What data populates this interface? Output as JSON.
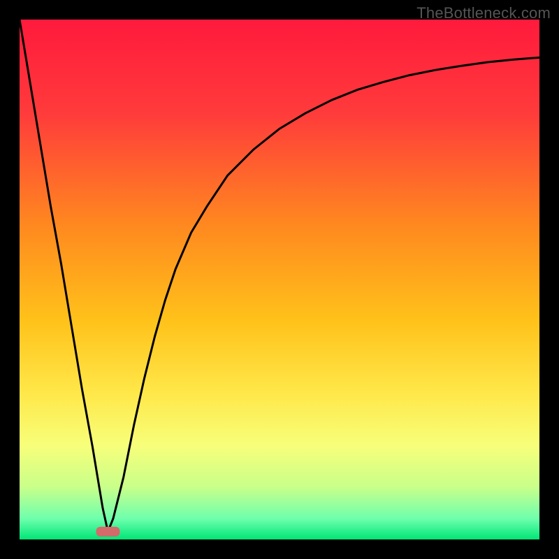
{
  "watermark": "TheBottleneck.com",
  "chart_data": {
    "type": "line",
    "title": "",
    "xlabel": "",
    "ylabel": "",
    "xlim": [
      0,
      100
    ],
    "ylim": [
      0,
      100
    ],
    "grid": false,
    "background_gradient": {
      "top": "#ff1744",
      "upper_mid": "#ff8a00",
      "mid": "#ffd500",
      "lower_mid": "#f4ff6a",
      "near_bottom": "#a8ff78",
      "bottom": "#00e676"
    },
    "marker": {
      "x": 17,
      "y": 1.5,
      "color": "#d46a6a",
      "shape": "rounded-rect"
    },
    "series": [
      {
        "name": "curve",
        "x": [
          0,
          2,
          4,
          6,
          8,
          10,
          12,
          14,
          16,
          17,
          18,
          20,
          22,
          24,
          26,
          28,
          30,
          33,
          36,
          40,
          45,
          50,
          55,
          60,
          65,
          70,
          75,
          80,
          85,
          90,
          95,
          100
        ],
        "values": [
          100,
          88,
          76,
          64,
          53,
          41,
          29,
          18,
          6,
          1.5,
          4,
          12,
          22,
          31,
          39,
          46,
          52,
          59,
          64,
          70,
          75,
          79,
          82,
          84.5,
          86.5,
          88,
          89.3,
          90.3,
          91.1,
          91.8,
          92.3,
          92.7
        ]
      }
    ]
  }
}
